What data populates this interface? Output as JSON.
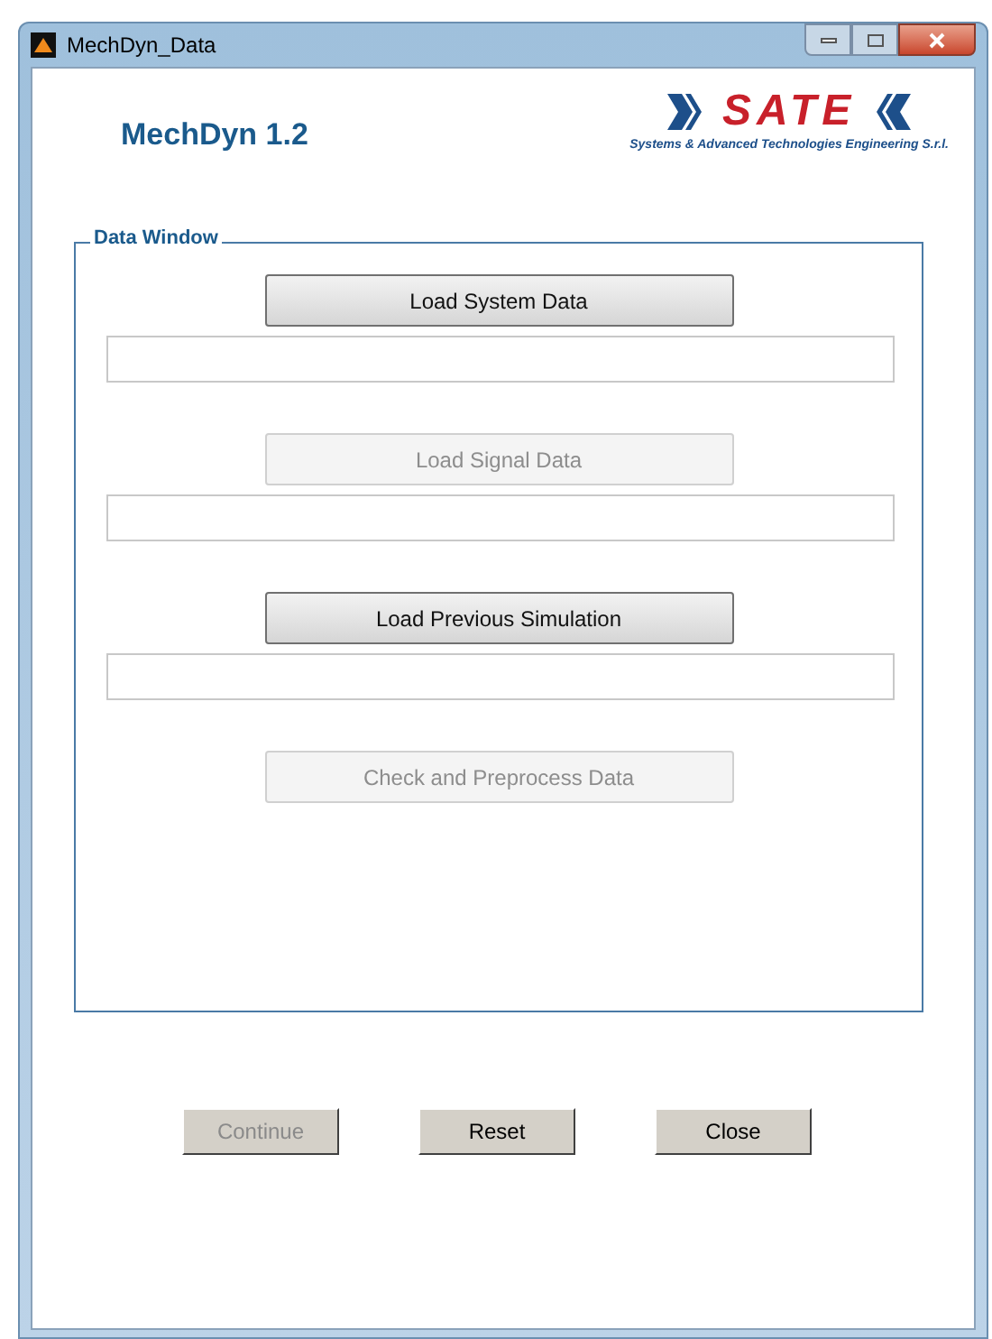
{
  "window": {
    "title": "MechDyn_Data"
  },
  "header": {
    "app_title": "MechDyn 1.2",
    "logo_text": "SATE",
    "logo_subtitle": "Systems & Advanced Technologies Engineering S.r.l."
  },
  "data_window": {
    "legend": "Data Window",
    "items": [
      {
        "kind": "button",
        "label": "Load System Data",
        "disabled": false
      },
      {
        "kind": "field"
      },
      {
        "kind": "button",
        "label": "Load Signal Data",
        "disabled": true
      },
      {
        "kind": "field"
      },
      {
        "kind": "button",
        "label": "Load Previous Simulation",
        "disabled": false
      },
      {
        "kind": "field"
      },
      {
        "kind": "button",
        "label": "Check and Preprocess Data",
        "disabled": true
      }
    ]
  },
  "buttons": [
    {
      "label": "Continue",
      "disabled": true
    },
    {
      "label": "Reset",
      "disabled": false
    },
    {
      "label": "Close",
      "disabled": false
    }
  ]
}
